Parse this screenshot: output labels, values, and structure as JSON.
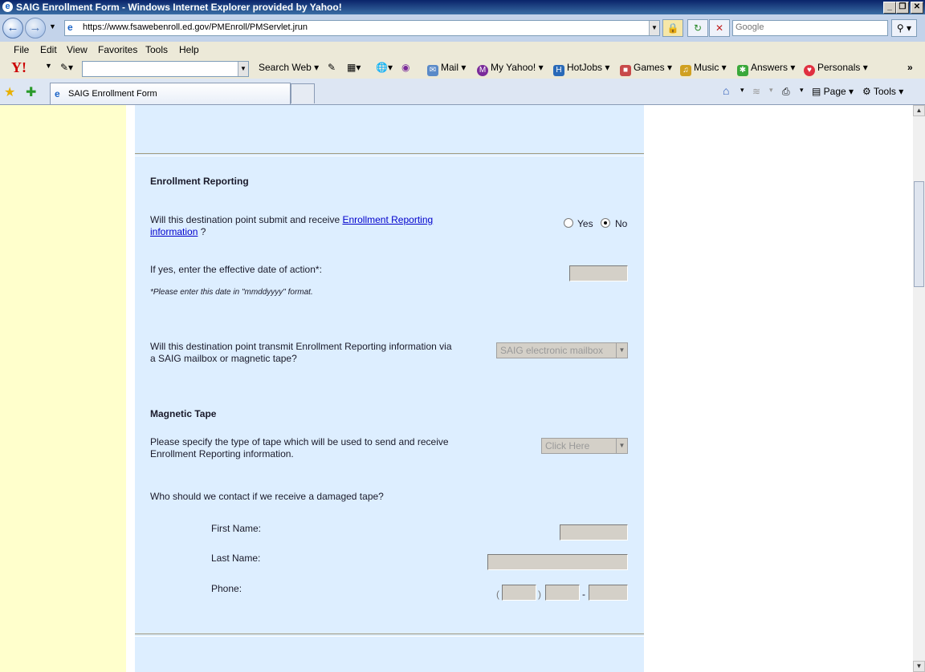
{
  "window": {
    "title": "SAIG Enrollment Form - Windows Internet Explorer provided by Yahoo!",
    "min_label": "_",
    "max_label": "❐",
    "close_label": "✕"
  },
  "address": {
    "url": "https://www.fsawebenroll.ed.gov/PMEnroll/PMServlet.jrun",
    "search_placeholder": "Google"
  },
  "menu": [
    "File",
    "Edit",
    "View",
    "Favorites",
    "Tools",
    "Help"
  ],
  "yahoo_toolbar": {
    "logo": "Y!",
    "search_web": "Search Web",
    "mail": "Mail",
    "my_yahoo": "My Yahoo!",
    "hotjobs": "HotJobs",
    "games": "Games",
    "music": "Music",
    "answers": "Answers",
    "personals": "Personals"
  },
  "tabs": {
    "active_tab": "SAIG Enrollment Form",
    "page_label": "Page",
    "tools_label": "Tools"
  },
  "form": {
    "section_title": "Enrollment Reporting",
    "q1_prefix": "Will this destination point submit and receive ",
    "q1_link_line1": "Enrollment Reporting",
    "q1_link_line2": "information",
    "q1_suffix": " ?",
    "yes_label": "Yes",
    "no_label": "No",
    "selected": "No",
    "date_label": "If yes, enter the effective date of action*:",
    "date_note": "*Please enter this date in \"mmddyyyy\" format.",
    "transmit_q_line1": "Will this destination point transmit Enrollment Reporting information via",
    "transmit_q_line2": "a SAIG mailbox or magnetic tape?",
    "transmit_value": "SAIG electronic mailbox",
    "tape_section": "Magnetic Tape",
    "tape_q_line1": "Please specify the type of tape which will be used to send and receive",
    "tape_q_line2": "Enrollment Reporting information.",
    "tape_value": "Click Here",
    "contact_q": "Who should we contact if we receive a damaged tape?",
    "first_name_label": "First Name:",
    "last_name_label": "Last Name:",
    "phone_label": "Phone:",
    "phone_open": "(",
    "phone_close": ")",
    "phone_dash": "-"
  }
}
